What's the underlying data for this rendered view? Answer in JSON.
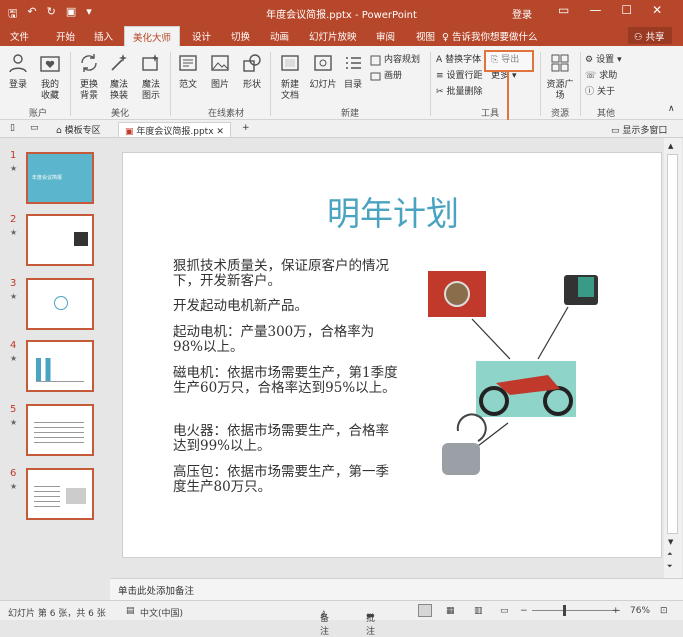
{
  "window": {
    "title": "年度会议简报.pptx - PowerPoint",
    "login": "登录"
  },
  "tabs": [
    "文件",
    "开始",
    "插入",
    "美化大师",
    "设计",
    "切换",
    "动画",
    "幻灯片放映",
    "审阅",
    "视图"
  ],
  "active_tab": "美化大师",
  "tell_me": "告诉我你想要做什么",
  "share": "共享",
  "ribbon": {
    "account": {
      "label": "账户",
      "login": "登录",
      "fav": "我的收藏"
    },
    "beautify": {
      "label": "美化",
      "replace_bg": "更换背景",
      "magic_replace": "魔法换装",
      "magic_diagram": "魔法图示"
    },
    "online": {
      "label": "在线素材",
      "template": "范文",
      "image": "图片",
      "shape": "形状"
    },
    "new": {
      "label": "新建",
      "new_doc": "新建文档",
      "slide": "幻灯片",
      "toc": "目录",
      "content_plan": "内容规划",
      "album": "画册"
    },
    "tools": {
      "label": "工具",
      "replace_font": "替换字体",
      "export": "导出",
      "line_spacing": "设置行距",
      "batch_delete": "批量删除",
      "more": "更多"
    },
    "resources": {
      "label": "资源",
      "plaza": "资源广场"
    },
    "other": {
      "label": "其他",
      "settings": "设置",
      "help": "求助",
      "about": "关于"
    }
  },
  "callout": "单击",
  "doc_tabs": {
    "templates": "模板专区",
    "current": "年度会议简报.pptx",
    "show_multi": "显示多窗口"
  },
  "slides": [
    {
      "num": "1",
      "caption": "年度会议简报"
    },
    {
      "num": "2",
      "caption": ""
    },
    {
      "num": "3",
      "caption": ""
    },
    {
      "num": "4",
      "caption": ""
    },
    {
      "num": "5",
      "caption": ""
    },
    {
      "num": "6",
      "caption": ""
    }
  ],
  "slide": {
    "title": "明年计划",
    "paragraphs": [
      "狠抓技术质量关，保证原客户的情况下，开发新客户。",
      "开发起动电机新产品。",
      "起动电机：产量300万，合格率为98%以上。",
      "磁电机：依据市场需要生产，第1季度生产60万只，合格率达到95%以上。",
      "电火器：依据市场需要生产，合格率达到99%以上。",
      "高压包：依据市场需要生产，第一季度生产80万只。"
    ]
  },
  "notes_placeholder": "单击此处添加备注",
  "status": {
    "slide_info": "幻灯片 第 6 张，共 6 张",
    "language": "中文(中国)",
    "notes": "备注",
    "comments": "批注",
    "zoom": "76%"
  },
  "colors": {
    "accent": "#b7472a",
    "title_blue": "#4aa3c0",
    "highlight": "#e0743a"
  }
}
